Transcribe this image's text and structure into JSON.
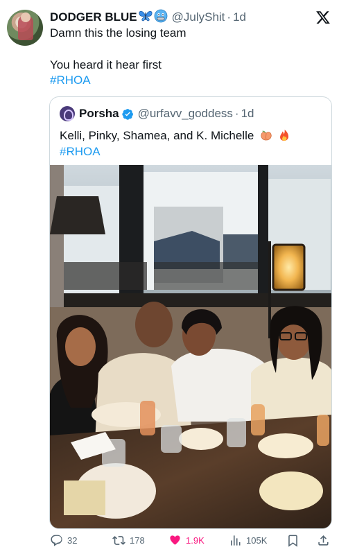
{
  "tweet": {
    "author_name": "DODGER BLUE",
    "author_emojis": [
      "butterfly-emoji",
      "cold-face-emoji"
    ],
    "handle": "@JulyShit",
    "separator": "·",
    "time": "1d",
    "text_line1": "Damn this the losing team",
    "text_line2": "You heard it hear first",
    "hashtag": "#RHOA"
  },
  "quote": {
    "author_name": "Porsha",
    "verified": true,
    "handle": "@urfavv_goddess",
    "separator": "·",
    "time": "1d",
    "text": "Kelli, Pinky, Shamea, and K. Michelle",
    "text_emojis": [
      "peach-emoji",
      "fire-emoji"
    ],
    "hashtag": "#RHOA",
    "photo_description_icon": "group-photo"
  },
  "actions": {
    "replies": "32",
    "reposts": "178",
    "likes": "1.9K",
    "views": "105K"
  },
  "colors": {
    "accent": "#1d9bf0",
    "like": "#f91880",
    "muted": "#536471",
    "border": "#cfd9de"
  }
}
